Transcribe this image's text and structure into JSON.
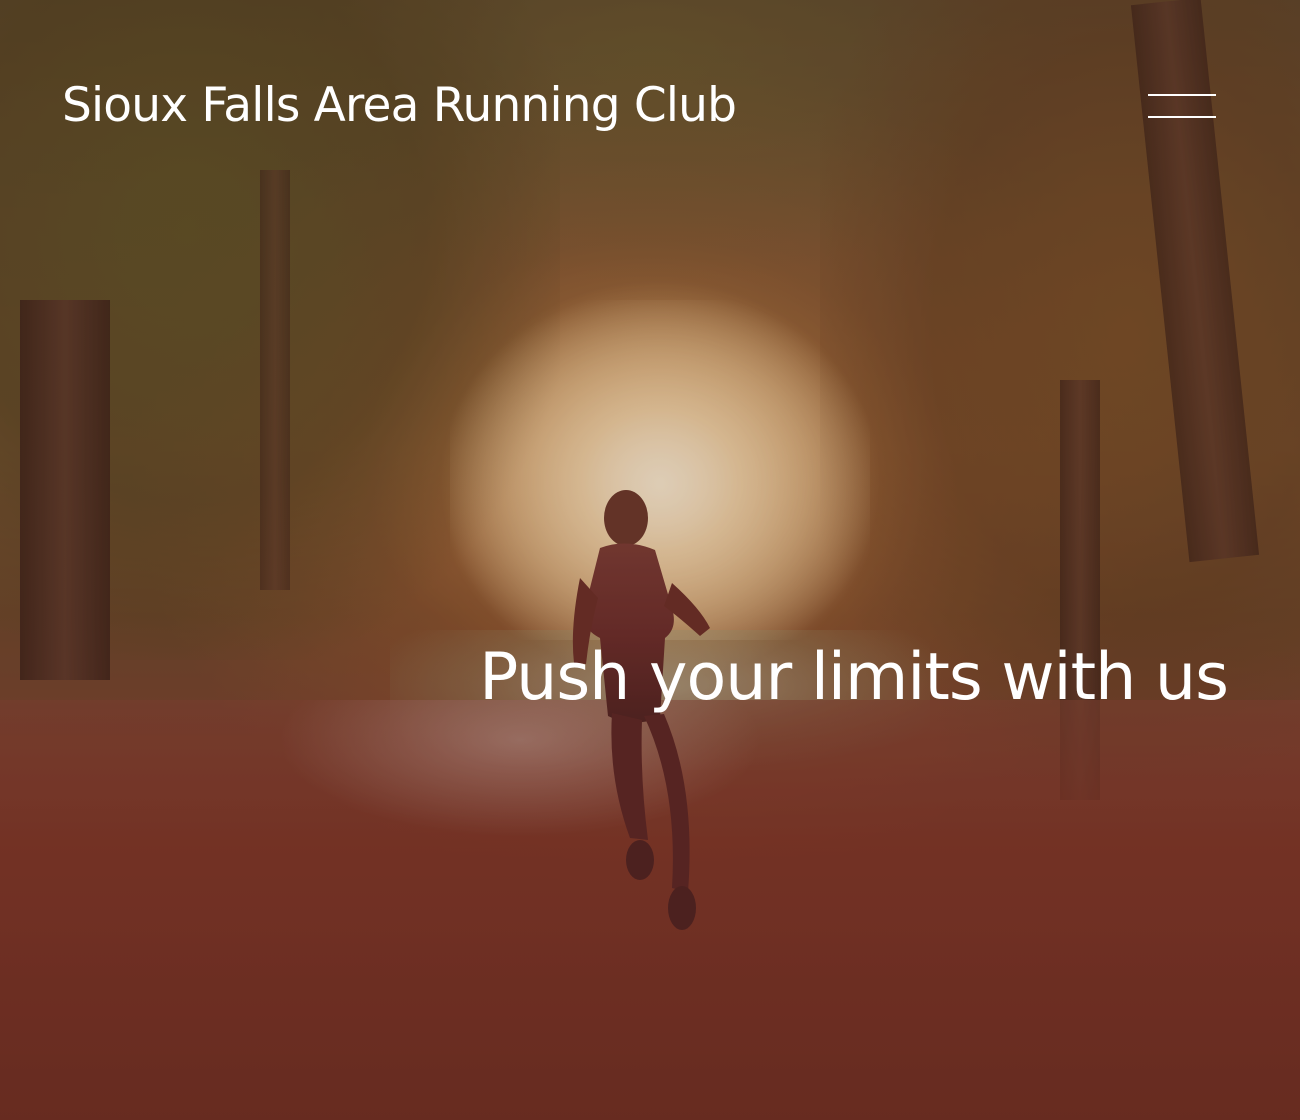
{
  "header": {
    "site_title": "Sioux Falls Area Running Club",
    "menu_icon": "hamburger-menu-icon"
  },
  "hero": {
    "tagline": "Push your limits with us",
    "background_image": "runner on sunlit forest path",
    "text_color": "#ffffff",
    "overlay_tint": "#46141e"
  }
}
